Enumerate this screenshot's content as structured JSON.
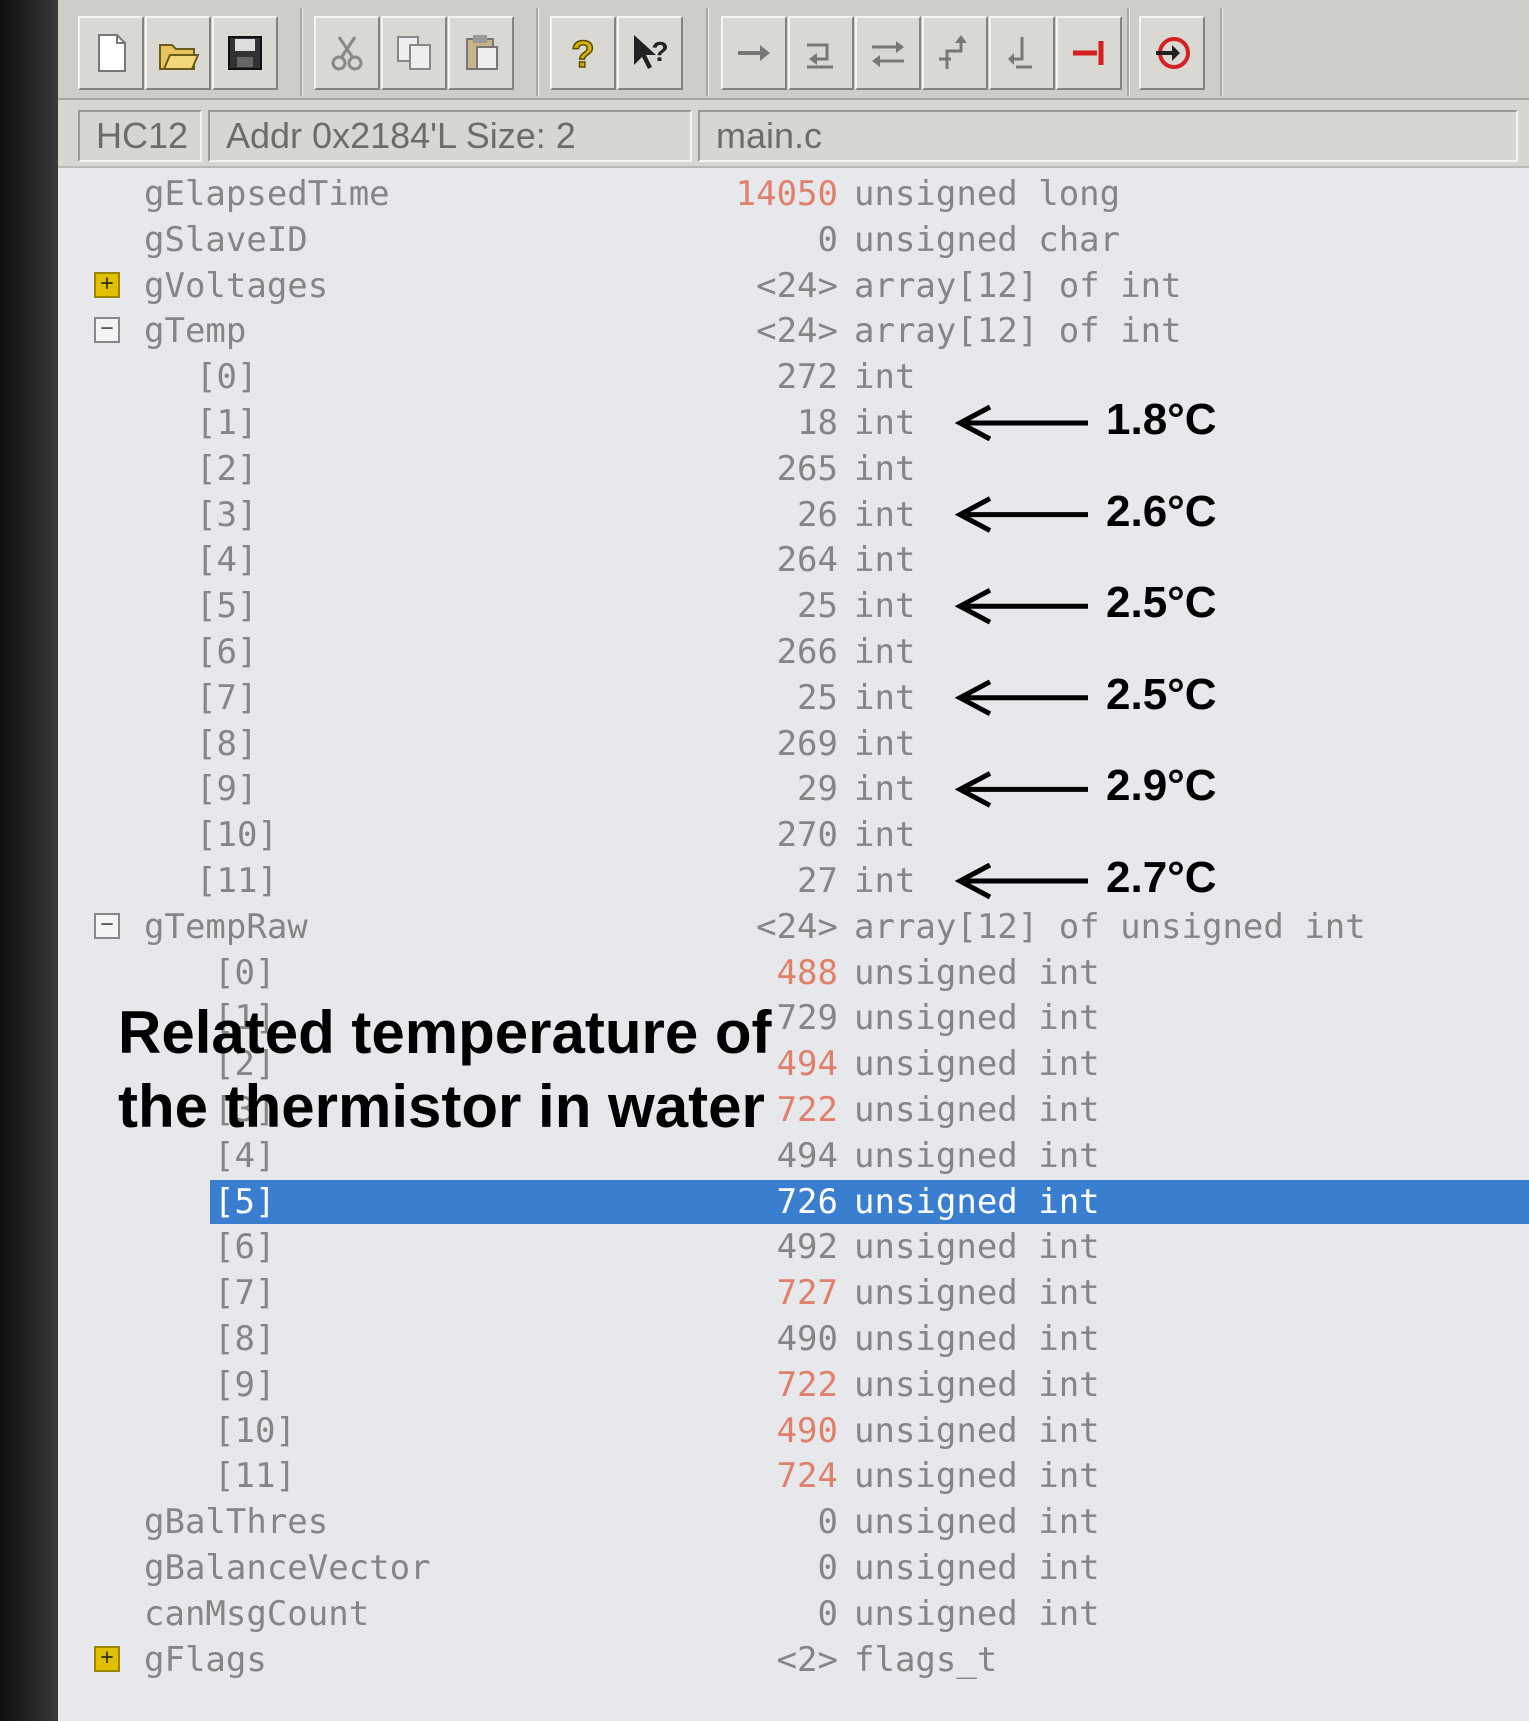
{
  "statusbar": {
    "target": "HC12",
    "address": "Addr  0x2184'L Size: 2",
    "module": "main.c"
  },
  "toolbar": {
    "buttons": [
      {
        "icon": "new-file-icon"
      },
      {
        "icon": "open-folder-icon"
      },
      {
        "icon": "save-icon"
      },
      {
        "icon": "cut-icon"
      },
      {
        "icon": "copy-icon"
      },
      {
        "icon": "paste-icon"
      },
      {
        "icon": "help-icon"
      },
      {
        "icon": "context-help-icon"
      },
      {
        "icon": "step-over-icon"
      },
      {
        "icon": "step-into-icon"
      },
      {
        "icon": "step-out-icon"
      },
      {
        "icon": "assembly-step-icon"
      },
      {
        "icon": "assembly-step-over-icon"
      },
      {
        "icon": "halt-icon"
      },
      {
        "icon": "reset-icon"
      }
    ]
  },
  "variables": [
    {
      "name": "gElapsedTime",
      "value": "14050",
      "type": "unsigned long",
      "changed": true
    },
    {
      "name": "gSlaveID",
      "value": "0",
      "type": "unsigned char"
    },
    {
      "name": "gVoltages",
      "value": "<24>",
      "type": "array[12] of int",
      "expander": "+"
    },
    {
      "name": "gTemp",
      "value": "<24>",
      "type": "array[12] of int",
      "expander": "-"
    },
    {
      "name": "[0]",
      "value": "272",
      "type": "int"
    },
    {
      "name": "[1]",
      "value": "18",
      "type": "int"
    },
    {
      "name": "[2]",
      "value": "265",
      "type": "int"
    },
    {
      "name": "[3]",
      "value": "26",
      "type": "int"
    },
    {
      "name": "[4]",
      "value": "264",
      "type": "int"
    },
    {
      "name": "[5]",
      "value": "25",
      "type": "int"
    },
    {
      "name": "[6]",
      "value": "266",
      "type": "int"
    },
    {
      "name": "[7]",
      "value": "25",
      "type": "int"
    },
    {
      "name": "[8]",
      "value": "269",
      "type": "int"
    },
    {
      "name": "[9]",
      "value": "29",
      "type": "int"
    },
    {
      "name": "[10]",
      "value": "270",
      "type": "int"
    },
    {
      "name": "[11]",
      "value": "27",
      "type": "int"
    },
    {
      "name": "gTempRaw",
      "value": "<24>",
      "type": "array[12] of unsigned int",
      "expander": "-"
    },
    {
      "name": "[0]",
      "value": "488",
      "type": "unsigned int",
      "changed": true
    },
    {
      "name": "[1]",
      "value": "729",
      "type": "unsigned int"
    },
    {
      "name": "[2]",
      "value": "494",
      "type": "unsigned int",
      "changed": true
    },
    {
      "name": "[3]",
      "value": "722",
      "type": "unsigned int",
      "changed": true
    },
    {
      "name": "[4]",
      "value": "494",
      "type": "unsigned int"
    },
    {
      "name": "[5]",
      "value": "726",
      "type": "unsigned int",
      "selected": true
    },
    {
      "name": "[6]",
      "value": "492",
      "type": "unsigned int"
    },
    {
      "name": "[7]",
      "value": "727",
      "type": "unsigned int",
      "changed": true
    },
    {
      "name": "[8]",
      "value": "490",
      "type": "unsigned int"
    },
    {
      "name": "[9]",
      "value": "722",
      "type": "unsigned int",
      "changed": true
    },
    {
      "name": "[10]",
      "value": "490",
      "type": "unsigned int",
      "changed": true
    },
    {
      "name": "[11]",
      "value": "724",
      "type": "unsigned int",
      "changed": true
    },
    {
      "name": "gBalThres",
      "value": "0",
      "type": "unsigned int"
    },
    {
      "name": "gBalanceVector",
      "value": "0",
      "type": "unsigned int"
    },
    {
      "name": "canMsgCount",
      "value": "0",
      "type": "unsigned int"
    },
    {
      "name": "gFlags",
      "value": "<2>",
      "type": "flags_t",
      "expander": "+"
    }
  ],
  "annotations": {
    "temps": [
      "1.8°C",
      "2.6°C",
      "2.5°C",
      "2.5°C",
      "2.9°C",
      "2.7°C"
    ],
    "caption_line1": "Related temperature of",
    "caption_line2": "the thermistor in water"
  },
  "colors": {
    "selection": "#3a7ed0",
    "changed_value": "#e0806a",
    "text": "#858585"
  }
}
